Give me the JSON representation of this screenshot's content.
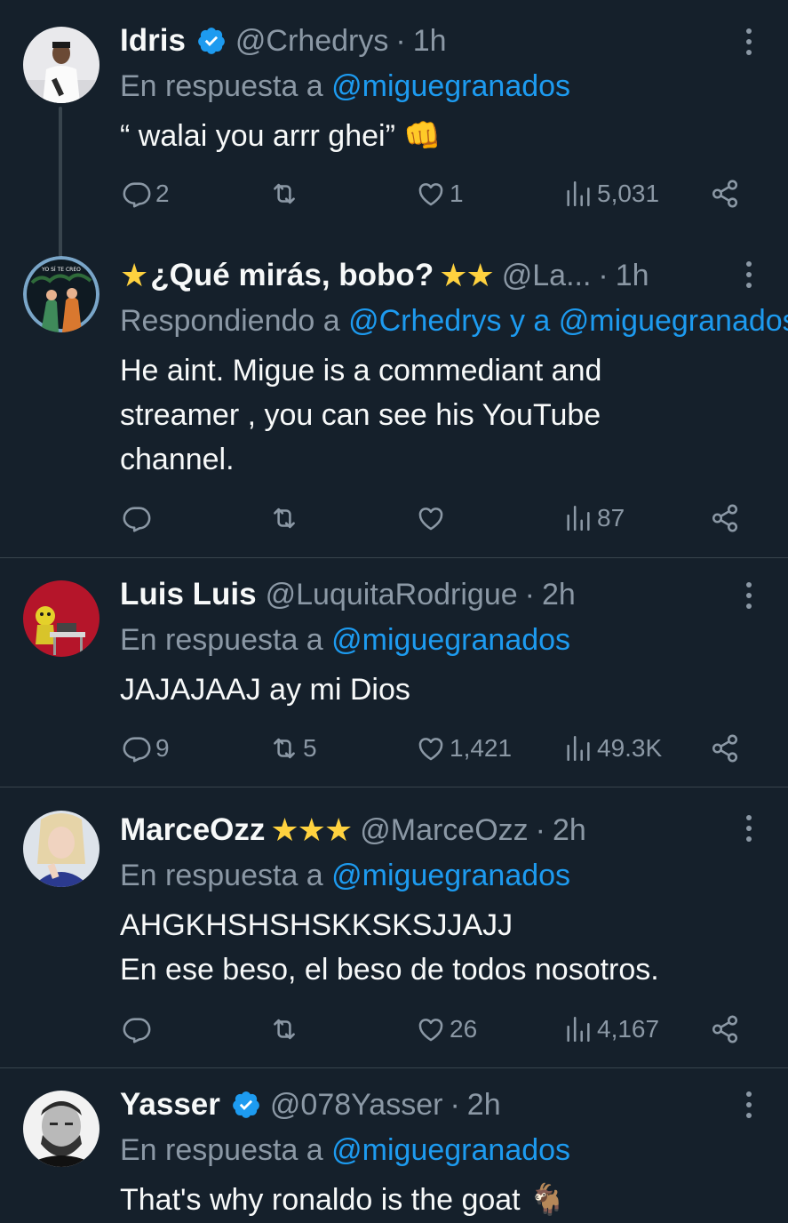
{
  "colors": {
    "background": "#15202b",
    "text": "#f7f9f9",
    "muted": "#8b98a5",
    "mention": "#1d9bf0",
    "verified": "#1d9bf0",
    "divider": "#38444d",
    "stars": "#ffd23f"
  },
  "tweets": [
    {
      "name": "Idris",
      "handle": "@Crhedrys",
      "dot": "·",
      "time": "1h",
      "verified": true,
      "reply_prefix": "En respuesta a ",
      "reply_mentions": "@miguegranados",
      "text": "“ walai you arrr ghei” 👊",
      "replies": "2",
      "retweets": "",
      "likes": "1",
      "views": "5,031",
      "avatar_icon": "person-in-white-shirt-avatar"
    },
    {
      "name_stars_lead": "★",
      "name": "¿Qué mirás, bobo?",
      "name_stars": "★★",
      "handle": "@La...",
      "dot": "·",
      "time": "1h",
      "reply_prefix": "Respondiendo a ",
      "reply_mentions": "@Crhedrys y a @miguegranados",
      "text": "He aint. Migue is a commediant and\nstreamer , you can see his YouTube\nchannel.",
      "replies": "",
      "retweets": "",
      "likes": "",
      "views": "87",
      "avatar_icon": "illustrated-couple-avatar",
      "avatar_text": "YO SÍ TE CREO"
    },
    {
      "name": "Luis Luis",
      "handle": "@LuquitaRodrigue",
      "dot": "·",
      "time": "2h",
      "reply_prefix": "En respuesta a ",
      "reply_mentions": "@miguegranados",
      "text": "JAJAJAAJ ay mi Dios",
      "replies": "9",
      "retweets": "5",
      "likes": "1,421",
      "views": "49.3K",
      "avatar_icon": "yellow-character-red-background-avatar"
    },
    {
      "name": "MarceOzz",
      "name_stars": "★★★",
      "handle": "@MarceOzz",
      "dot": "·",
      "time": "2h",
      "reply_prefix": "En respuesta a ",
      "reply_mentions": "@miguegranados",
      "text": "AHGKHSHSHSKKSKSJJAJJ\nEn ese beso, el beso de todos nosotros.",
      "replies": "",
      "retweets": "",
      "likes": "26",
      "views": "4,167",
      "avatar_icon": "blonde-person-selfie-avatar"
    },
    {
      "name": "Yasser",
      "handle": "@078Yasser",
      "dot": "·",
      "time": "2h",
      "verified": true,
      "reply_prefix": "En respuesta a ",
      "reply_mentions": "@miguegranados",
      "text": "That's why ronaldo is the goat 🐐",
      "replies": "",
      "retweets": "",
      "likes": "",
      "views": "",
      "avatar_icon": "black-and-white-man-avatar"
    }
  ]
}
